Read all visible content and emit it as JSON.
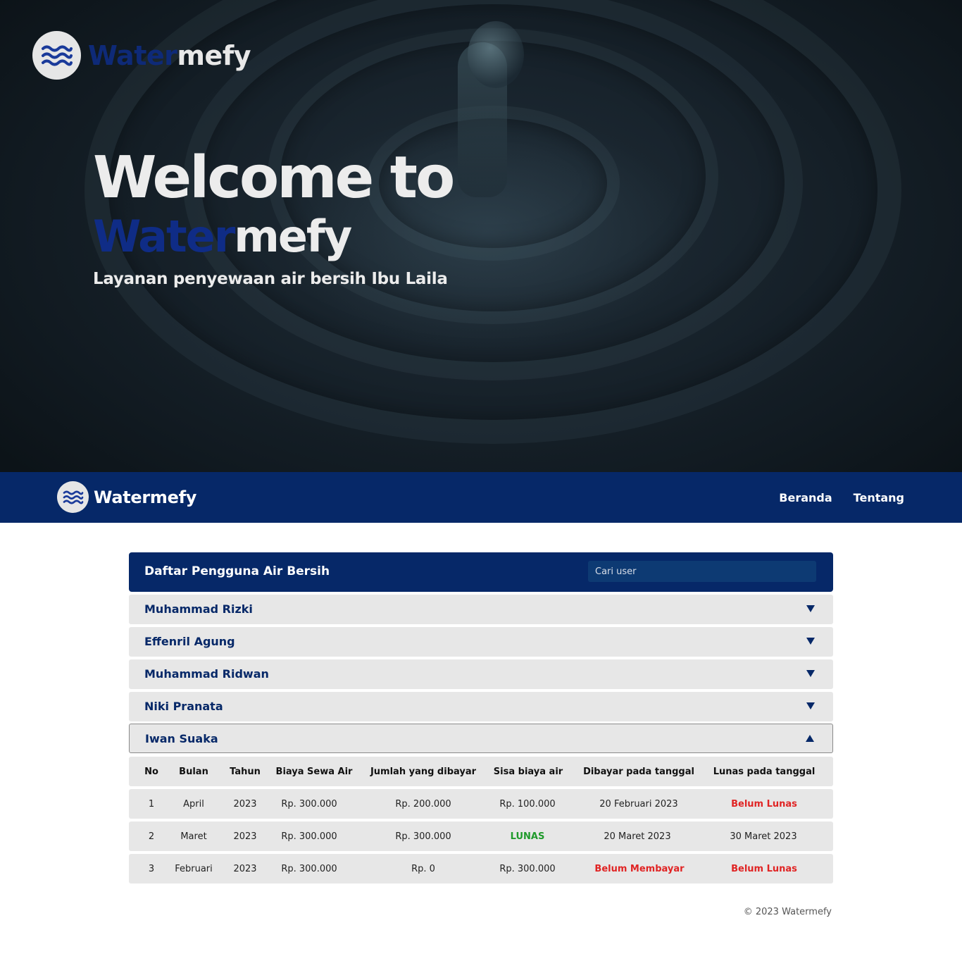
{
  "hero": {
    "brand_part1": "Water",
    "brand_part2": "mefy",
    "title": "Welcome to",
    "subtitle": "Layanan penyewaan air bersih Ibu Laila"
  },
  "navbar": {
    "brand": "Watermefy",
    "links": [
      "Beranda",
      "Tentang"
    ]
  },
  "panel": {
    "title": "Daftar Pengguna Air Bersih",
    "search_placeholder": "Cari user",
    "users": [
      {
        "name": "Muhammad Rizki",
        "expanded": false
      },
      {
        "name": "Effenril Agung",
        "expanded": false
      },
      {
        "name": "Muhammad Ridwan",
        "expanded": false
      },
      {
        "name": "Niki Pranata",
        "expanded": false
      },
      {
        "name": "Iwan Suaka",
        "expanded": true
      }
    ],
    "columns": [
      "No",
      "Bulan",
      "Tahun",
      "Biaya Sewa Air",
      "Jumlah yang dibayar",
      "Sisa biaya air",
      "Dibayar pada tanggal",
      "Lunas pada tanggal"
    ],
    "rows": [
      [
        "1",
        "April",
        "2023",
        "Rp. 300.000",
        "Rp. 200.000",
        "Rp. 100.000",
        "20 Februari 2023",
        "Belum Lunas"
      ],
      [
        "2",
        "Maret",
        "2023",
        "Rp. 300.000",
        "Rp. 300.000",
        "LUNAS",
        "20 Maret 2023",
        "30 Maret 2023"
      ],
      [
        "3",
        "Februari",
        "2023",
        "Rp. 300.000",
        "Rp. 0",
        "Rp. 300.000",
        "Belum Membayar",
        "Belum Lunas"
      ]
    ]
  },
  "footer": {
    "text": "© 2023 Watermefy"
  },
  "colors": {
    "navy": "#062868",
    "brand_blue": "#0f2c86",
    "row_bg": "#e7e7e7",
    "status_red": "#e02424",
    "status_green": "#1f9a2b"
  },
  "icons": {
    "logo": "water-waves-icon",
    "collapsed": "triangle-down-icon",
    "expanded": "triangle-up-icon"
  }
}
